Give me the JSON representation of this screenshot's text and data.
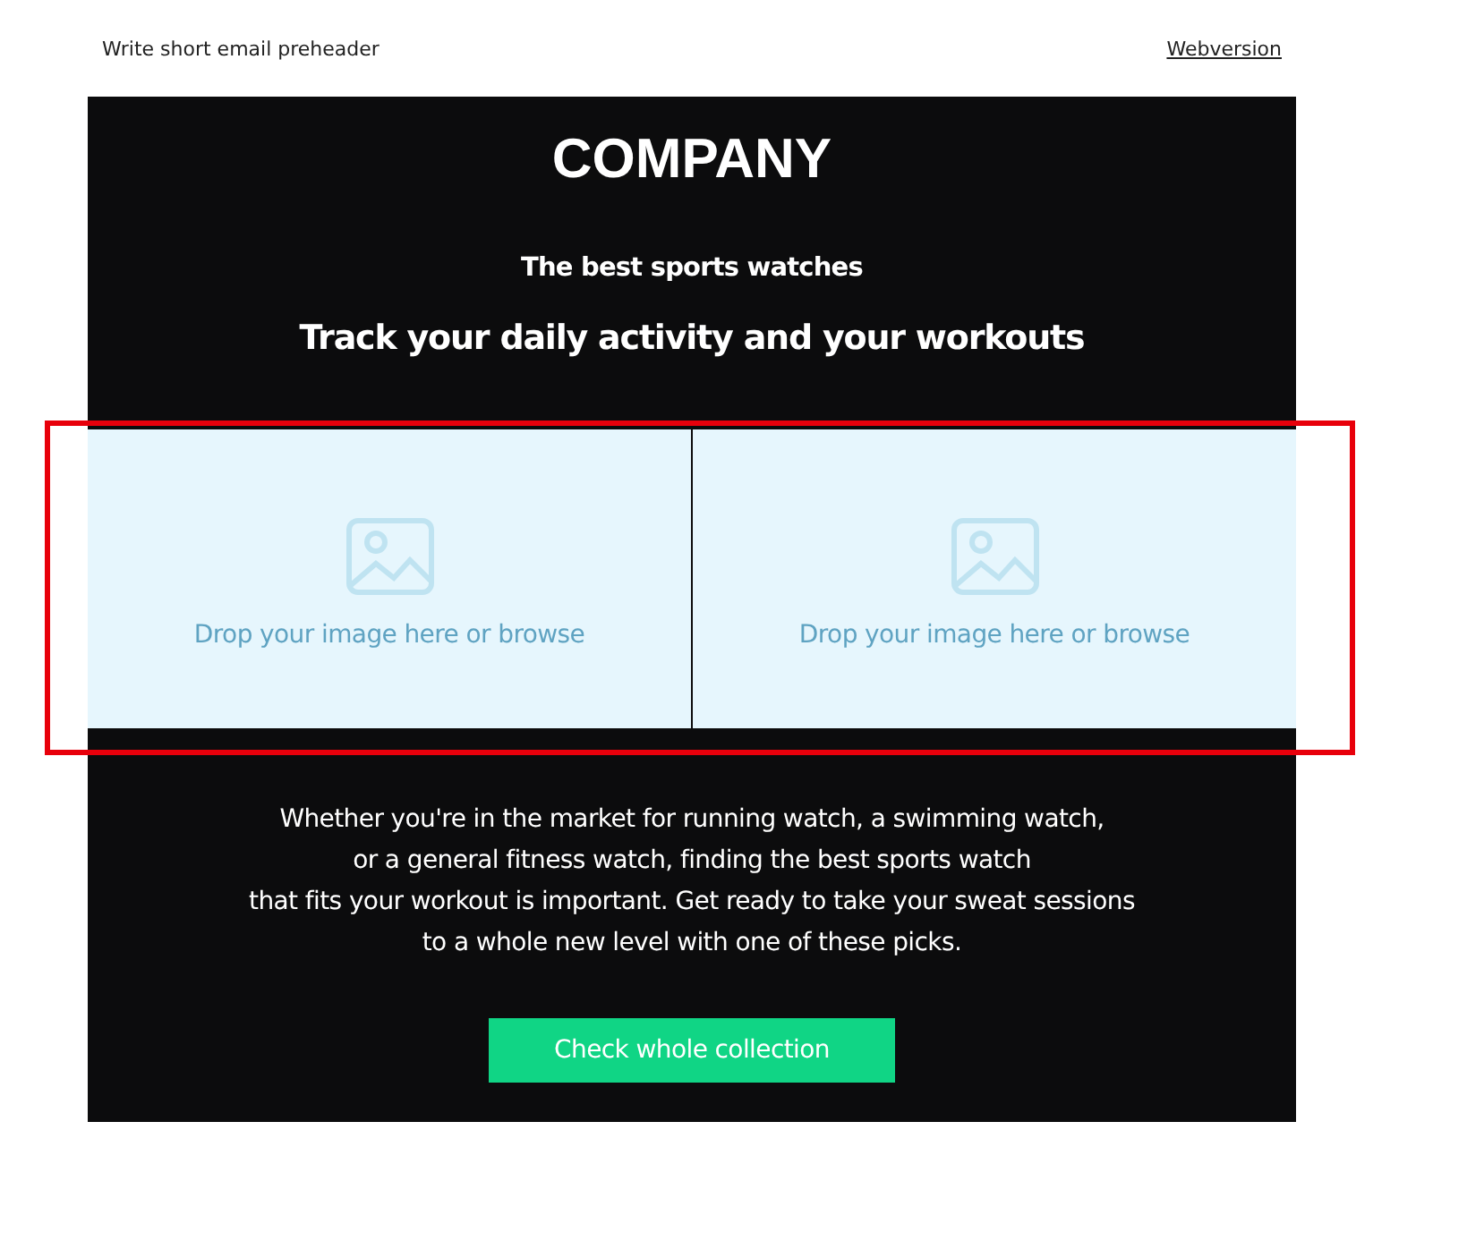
{
  "preheader": {
    "text": "Write short email preheader",
    "link": "Webversion"
  },
  "email": {
    "logo": "COMPANY",
    "subtitle": "The best sports watches",
    "heading": "Track your daily activity and your workouts",
    "images": [
      {
        "placeholder": "Drop your image here or browse"
      },
      {
        "placeholder": "Drop your image here or browse"
      }
    ],
    "body_lines": [
      "Whether you're in the market for running watch, a swimming watch,",
      "or a general fitness watch, finding the best sports watch",
      "that fits your workout is important. Get ready to take your sweat sessions",
      "to a whole new level with one of these picks."
    ],
    "button": "Check whole collection"
  },
  "highlight": {
    "color": "#e8000b"
  }
}
